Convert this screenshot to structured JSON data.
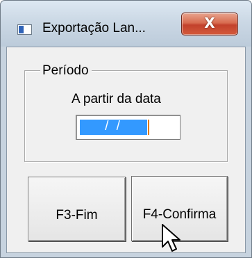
{
  "window": {
    "title": "Exportação Lan...",
    "close_glyph": "X"
  },
  "period_group": {
    "label": "Período",
    "date_label": "A partir da data",
    "date_value": " / / "
  },
  "buttons": {
    "finish_label": "F3-Fim",
    "confirm_label": "F4-Confirma"
  },
  "icons": {
    "app": "app-window-icon",
    "close": "close-icon",
    "cursor": "mouse-pointer-icon"
  },
  "colors": {
    "selection": "#3399ff",
    "close_button": "#c2412b",
    "caret": "#e07b1a"
  }
}
